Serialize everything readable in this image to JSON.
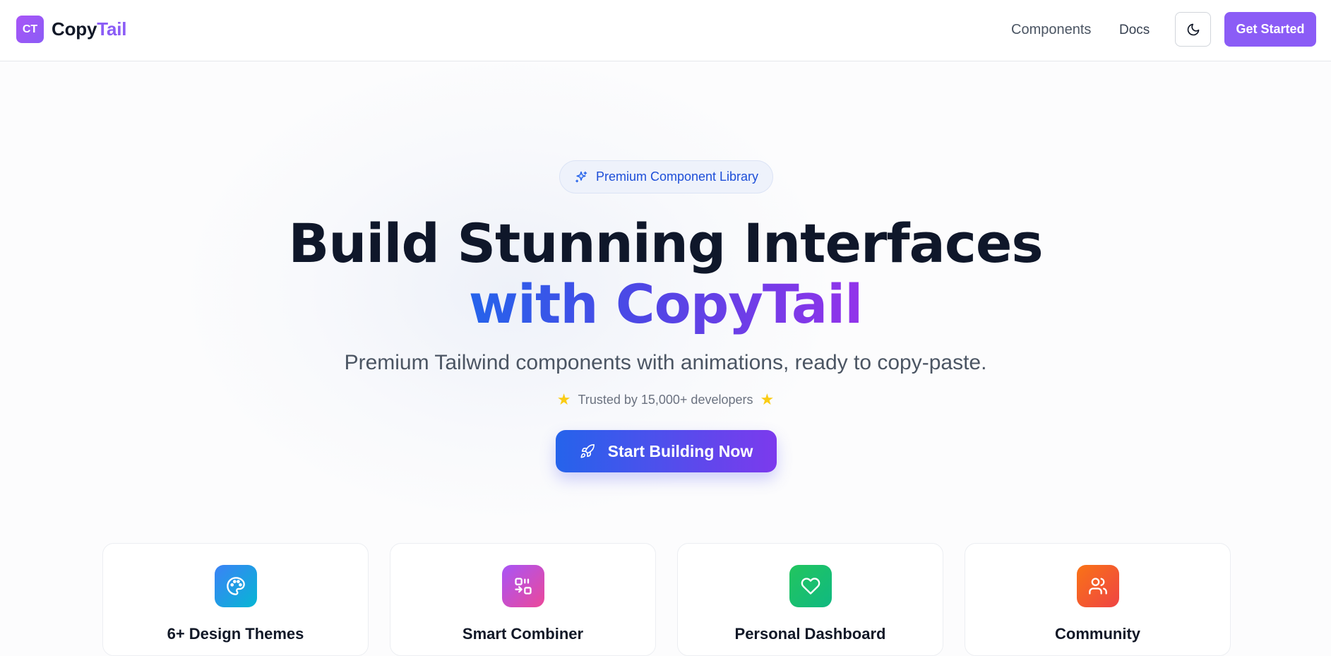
{
  "header": {
    "logo_badge": "CT",
    "logo_text_primary": "Copy",
    "logo_text_accent": "Tail",
    "nav": [
      {
        "label": "Components"
      },
      {
        "label": "Docs"
      }
    ],
    "theme_toggle_icon": "moon-icon",
    "cta_label": "Get Started"
  },
  "hero": {
    "badge_icon": "sparkles-icon",
    "badge_label": "Premium Component Library",
    "title_line1": "Build Stunning Interfaces",
    "title_line2": "with CopyTail",
    "subtitle": "Premium Tailwind components with animations, ready to copy-paste.",
    "trust_text": "Trusted by 15,000+ developers",
    "cta_icon": "rocket-icon",
    "cta_label": "Start Building Now"
  },
  "features": [
    {
      "title": "6+ Design Themes",
      "icon": "palette-icon",
      "color": "#0ea5e9"
    },
    {
      "title": "Smart Combiner",
      "icon": "combine-icon",
      "color": "#d946ef"
    },
    {
      "title": "Personal Dashboard",
      "icon": "heart-icon",
      "color": "#10b981"
    },
    {
      "title": "Community",
      "icon": "users-icon",
      "color": "#f97316"
    }
  ],
  "colors": {
    "brand": "#8b5cf6",
    "gradient_start": "#2563eb",
    "gradient_end": "#9333ea",
    "badge_text": "#1d4ed8",
    "star": "#facc15"
  }
}
